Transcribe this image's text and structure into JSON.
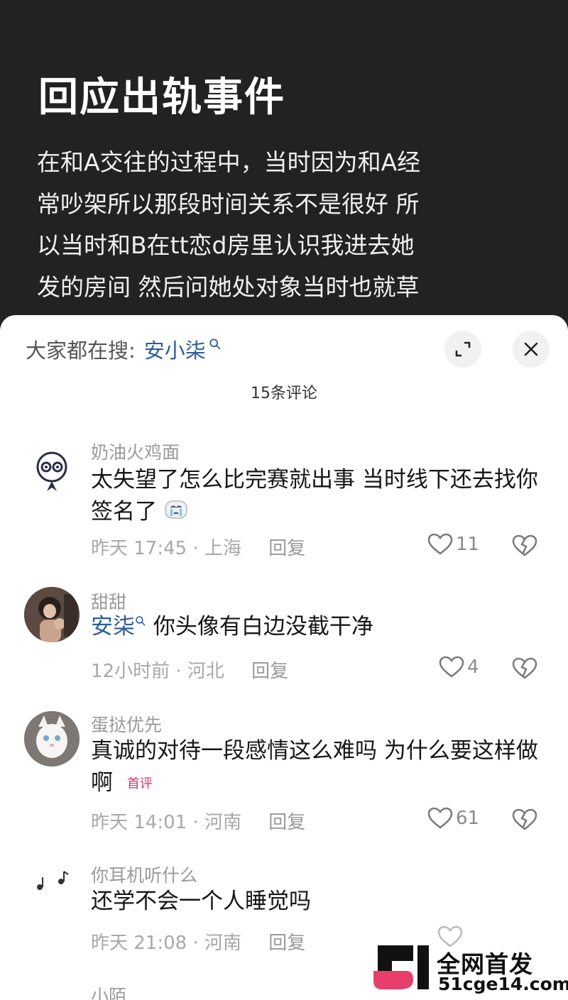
{
  "post": {
    "title": "回应出轨事件",
    "lines": [
      "在和A交往的过程中，当时因为和A经",
      "常吵架所以那段时间关系不是很好 所",
      "以当时和B在tt恋d房里认识我进去她",
      "发的房间 然后问她处对象当时也就草"
    ]
  },
  "sheet": {
    "search_prefix": "大家都在搜:",
    "search_term": "安小柒",
    "comment_count": "15条评论",
    "reply_label": "回复"
  },
  "comments": [
    {
      "name": "奶油火鸡面",
      "text": "太失望了怎么比完赛就出事 当时线下还去找你签名了",
      "time": "昨天 17:45 · 上海",
      "likes": "11",
      "avatar_icon": "cartoon-character-icon"
    },
    {
      "name": "甜甜",
      "mention": "安柒",
      "text": "你头像有白边没截干净",
      "time": "12小时前 · 河北",
      "likes": "4",
      "avatar_icon": "girl-photo-avatar"
    },
    {
      "name": "蛋挞优先",
      "text": "真诚的对待一段感情这么难吗 为什么要这样做啊",
      "badge": "首评",
      "time": "昨天 14:01 · 河南",
      "likes": "61",
      "avatar_icon": "white-cat-avatar"
    },
    {
      "name": "你耳机听什么",
      "text": "还学不会一个人睡觉吗",
      "time": "昨天 21:08 · 河南",
      "likes": "",
      "avatar_icon": "music-note-avatar"
    },
    {
      "name": "小陌"
    }
  ],
  "watermark": {
    "line1": "全网首发",
    "line2": "51cge14.com"
  },
  "colors": {
    "post_bg": "#222222",
    "mention": "#2c5c9a",
    "badge": "#d6336c"
  }
}
